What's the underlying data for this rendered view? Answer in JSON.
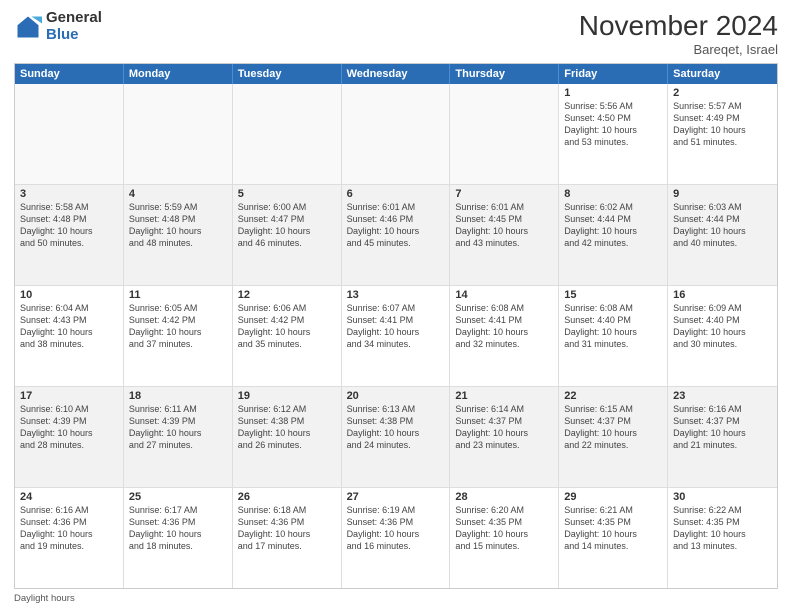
{
  "logo": {
    "general": "General",
    "blue": "Blue"
  },
  "header": {
    "month": "November 2024",
    "location": "Bareqet, Israel"
  },
  "weekdays": [
    "Sunday",
    "Monday",
    "Tuesday",
    "Wednesday",
    "Thursday",
    "Friday",
    "Saturday"
  ],
  "footer": {
    "daylight_label": "Daylight hours"
  },
  "rows": [
    {
      "alt": false,
      "cells": [
        {
          "day": "",
          "info": ""
        },
        {
          "day": "",
          "info": ""
        },
        {
          "day": "",
          "info": ""
        },
        {
          "day": "",
          "info": ""
        },
        {
          "day": "",
          "info": ""
        },
        {
          "day": "1",
          "info": "Sunrise: 5:56 AM\nSunset: 4:50 PM\nDaylight: 10 hours\nand 53 minutes."
        },
        {
          "day": "2",
          "info": "Sunrise: 5:57 AM\nSunset: 4:49 PM\nDaylight: 10 hours\nand 51 minutes."
        }
      ]
    },
    {
      "alt": true,
      "cells": [
        {
          "day": "3",
          "info": "Sunrise: 5:58 AM\nSunset: 4:48 PM\nDaylight: 10 hours\nand 50 minutes."
        },
        {
          "day": "4",
          "info": "Sunrise: 5:59 AM\nSunset: 4:48 PM\nDaylight: 10 hours\nand 48 minutes."
        },
        {
          "day": "5",
          "info": "Sunrise: 6:00 AM\nSunset: 4:47 PM\nDaylight: 10 hours\nand 46 minutes."
        },
        {
          "day": "6",
          "info": "Sunrise: 6:01 AM\nSunset: 4:46 PM\nDaylight: 10 hours\nand 45 minutes."
        },
        {
          "day": "7",
          "info": "Sunrise: 6:01 AM\nSunset: 4:45 PM\nDaylight: 10 hours\nand 43 minutes."
        },
        {
          "day": "8",
          "info": "Sunrise: 6:02 AM\nSunset: 4:44 PM\nDaylight: 10 hours\nand 42 minutes."
        },
        {
          "day": "9",
          "info": "Sunrise: 6:03 AM\nSunset: 4:44 PM\nDaylight: 10 hours\nand 40 minutes."
        }
      ]
    },
    {
      "alt": false,
      "cells": [
        {
          "day": "10",
          "info": "Sunrise: 6:04 AM\nSunset: 4:43 PM\nDaylight: 10 hours\nand 38 minutes."
        },
        {
          "day": "11",
          "info": "Sunrise: 6:05 AM\nSunset: 4:42 PM\nDaylight: 10 hours\nand 37 minutes."
        },
        {
          "day": "12",
          "info": "Sunrise: 6:06 AM\nSunset: 4:42 PM\nDaylight: 10 hours\nand 35 minutes."
        },
        {
          "day": "13",
          "info": "Sunrise: 6:07 AM\nSunset: 4:41 PM\nDaylight: 10 hours\nand 34 minutes."
        },
        {
          "day": "14",
          "info": "Sunrise: 6:08 AM\nSunset: 4:41 PM\nDaylight: 10 hours\nand 32 minutes."
        },
        {
          "day": "15",
          "info": "Sunrise: 6:08 AM\nSunset: 4:40 PM\nDaylight: 10 hours\nand 31 minutes."
        },
        {
          "day": "16",
          "info": "Sunrise: 6:09 AM\nSunset: 4:40 PM\nDaylight: 10 hours\nand 30 minutes."
        }
      ]
    },
    {
      "alt": true,
      "cells": [
        {
          "day": "17",
          "info": "Sunrise: 6:10 AM\nSunset: 4:39 PM\nDaylight: 10 hours\nand 28 minutes."
        },
        {
          "day": "18",
          "info": "Sunrise: 6:11 AM\nSunset: 4:39 PM\nDaylight: 10 hours\nand 27 minutes."
        },
        {
          "day": "19",
          "info": "Sunrise: 6:12 AM\nSunset: 4:38 PM\nDaylight: 10 hours\nand 26 minutes."
        },
        {
          "day": "20",
          "info": "Sunrise: 6:13 AM\nSunset: 4:38 PM\nDaylight: 10 hours\nand 24 minutes."
        },
        {
          "day": "21",
          "info": "Sunrise: 6:14 AM\nSunset: 4:37 PM\nDaylight: 10 hours\nand 23 minutes."
        },
        {
          "day": "22",
          "info": "Sunrise: 6:15 AM\nSunset: 4:37 PM\nDaylight: 10 hours\nand 22 minutes."
        },
        {
          "day": "23",
          "info": "Sunrise: 6:16 AM\nSunset: 4:37 PM\nDaylight: 10 hours\nand 21 minutes."
        }
      ]
    },
    {
      "alt": false,
      "cells": [
        {
          "day": "24",
          "info": "Sunrise: 6:16 AM\nSunset: 4:36 PM\nDaylight: 10 hours\nand 19 minutes."
        },
        {
          "day": "25",
          "info": "Sunrise: 6:17 AM\nSunset: 4:36 PM\nDaylight: 10 hours\nand 18 minutes."
        },
        {
          "day": "26",
          "info": "Sunrise: 6:18 AM\nSunset: 4:36 PM\nDaylight: 10 hours\nand 17 minutes."
        },
        {
          "day": "27",
          "info": "Sunrise: 6:19 AM\nSunset: 4:36 PM\nDaylight: 10 hours\nand 16 minutes."
        },
        {
          "day": "28",
          "info": "Sunrise: 6:20 AM\nSunset: 4:35 PM\nDaylight: 10 hours\nand 15 minutes."
        },
        {
          "day": "29",
          "info": "Sunrise: 6:21 AM\nSunset: 4:35 PM\nDaylight: 10 hours\nand 14 minutes."
        },
        {
          "day": "30",
          "info": "Sunrise: 6:22 AM\nSunset: 4:35 PM\nDaylight: 10 hours\nand 13 minutes."
        }
      ]
    }
  ]
}
